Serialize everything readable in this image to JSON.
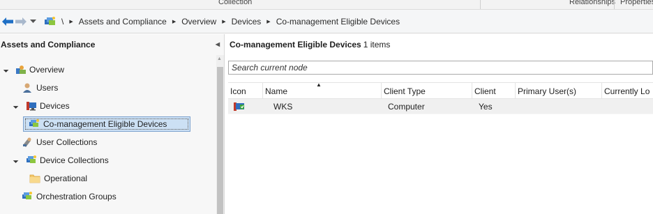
{
  "ribbon": {
    "left_label": "Collection",
    "right_label_1": "Relationships",
    "right_label_2": "Properties"
  },
  "address_bar": {
    "root_label": "\\",
    "crumbs": [
      "Assets and Compliance",
      "Overview",
      "Devices",
      "Co-management Eligible Devices"
    ]
  },
  "left_pane": {
    "title": "Assets and Compliance",
    "tree": [
      {
        "label": "Overview",
        "icon": "overview-icon"
      },
      {
        "label": "Users",
        "icon": "user-icon"
      },
      {
        "label": "Devices",
        "icon": "devices-icon"
      },
      {
        "label": "Co-management Eligible Devices",
        "icon": "collection-icon",
        "selected": true
      },
      {
        "label": "User Collections",
        "icon": "user-collections-icon"
      },
      {
        "label": "Device Collections",
        "icon": "device-collections-icon"
      },
      {
        "label": "Operational",
        "icon": "folder-icon"
      },
      {
        "label": "Orchestration Groups",
        "icon": "orchestration-icon"
      }
    ]
  },
  "right_pane": {
    "title": "Co-management Eligible Devices",
    "count": "1 items",
    "search_placeholder": "Search current node",
    "columns": [
      "Icon",
      "Name",
      "Client Type",
      "Client",
      "Primary User(s)",
      "Currently Lo"
    ],
    "rows": [
      {
        "icon": "computer-client-icon",
        "name": "WKS",
        "client_type": "Computer",
        "client": "Yes",
        "primary_users": "",
        "currently_logged": ""
      }
    ]
  },
  "colors": {
    "selection_bg": "#cce0f4",
    "selection_border": "#7da2ce",
    "row_bg": "#f0f0f0",
    "back_arrow": "#1f6fc5"
  }
}
